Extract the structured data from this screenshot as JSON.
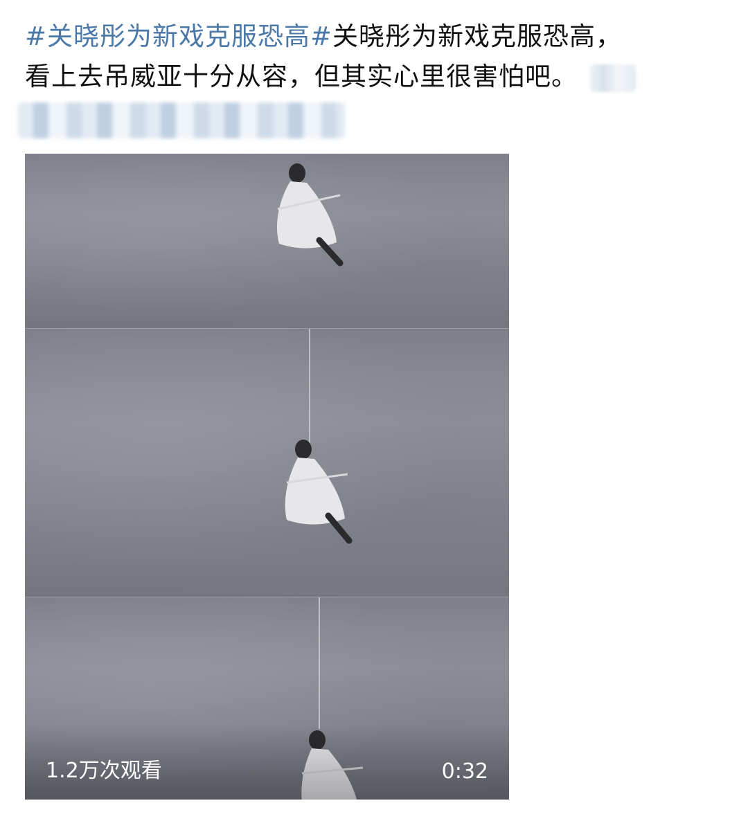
{
  "post": {
    "topic_tag": "#关晓彤为新戏克服恐高#",
    "line1_rest": "关晓彤为新戏克服恐高，",
    "line2": "看上去吊威亚十分从容，但其实心里很害怕吧。"
  },
  "video": {
    "view_count": "1.2万次观看",
    "duration": "0:32"
  },
  "colors": {
    "topic_link": "#4a78a8",
    "text": "#111111",
    "overlay_text": "#ffffff"
  }
}
